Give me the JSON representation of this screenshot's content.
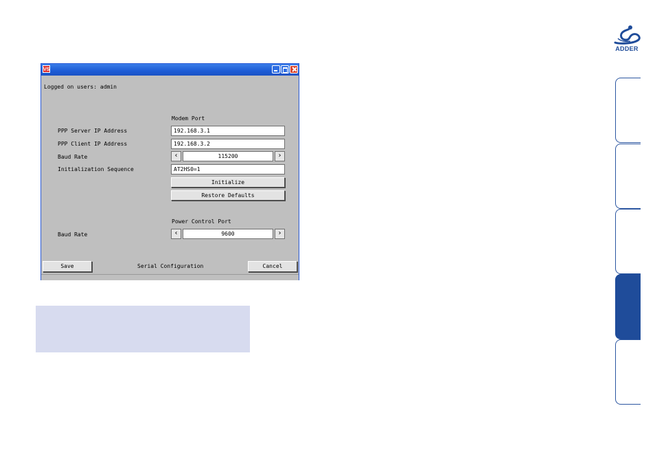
{
  "brand": {
    "logo_text": "ADDER",
    "color": "#1f4c9a"
  },
  "window": {
    "app_icon_text": "VS",
    "logged_on": "Logged on users: admin",
    "modem_port": {
      "heading": "Modem Port",
      "ppp_server_label": "PPP Server IP Address",
      "ppp_server_value": "192.168.3.1",
      "ppp_client_label": "PPP Client IP Address",
      "ppp_client_value": "192.168.3.2",
      "baud_label": "Baud Rate",
      "baud_value": "115200",
      "init_label": "Initialization Sequence",
      "init_value": "AT2HS0=1",
      "initialize_button": "Initialize",
      "restore_button": "Restore Defaults"
    },
    "power_port": {
      "heading": "Power Control Port",
      "baud_label": "Baud Rate",
      "baud_value": "9600"
    },
    "footer": {
      "save_button": "Save",
      "title": "Serial Configuration",
      "cancel_button": "Cancel"
    },
    "icons": {
      "left_arrow": "‹",
      "right_arrow": "›"
    }
  },
  "side_tabs": {
    "count": 5,
    "active_index": 3
  }
}
